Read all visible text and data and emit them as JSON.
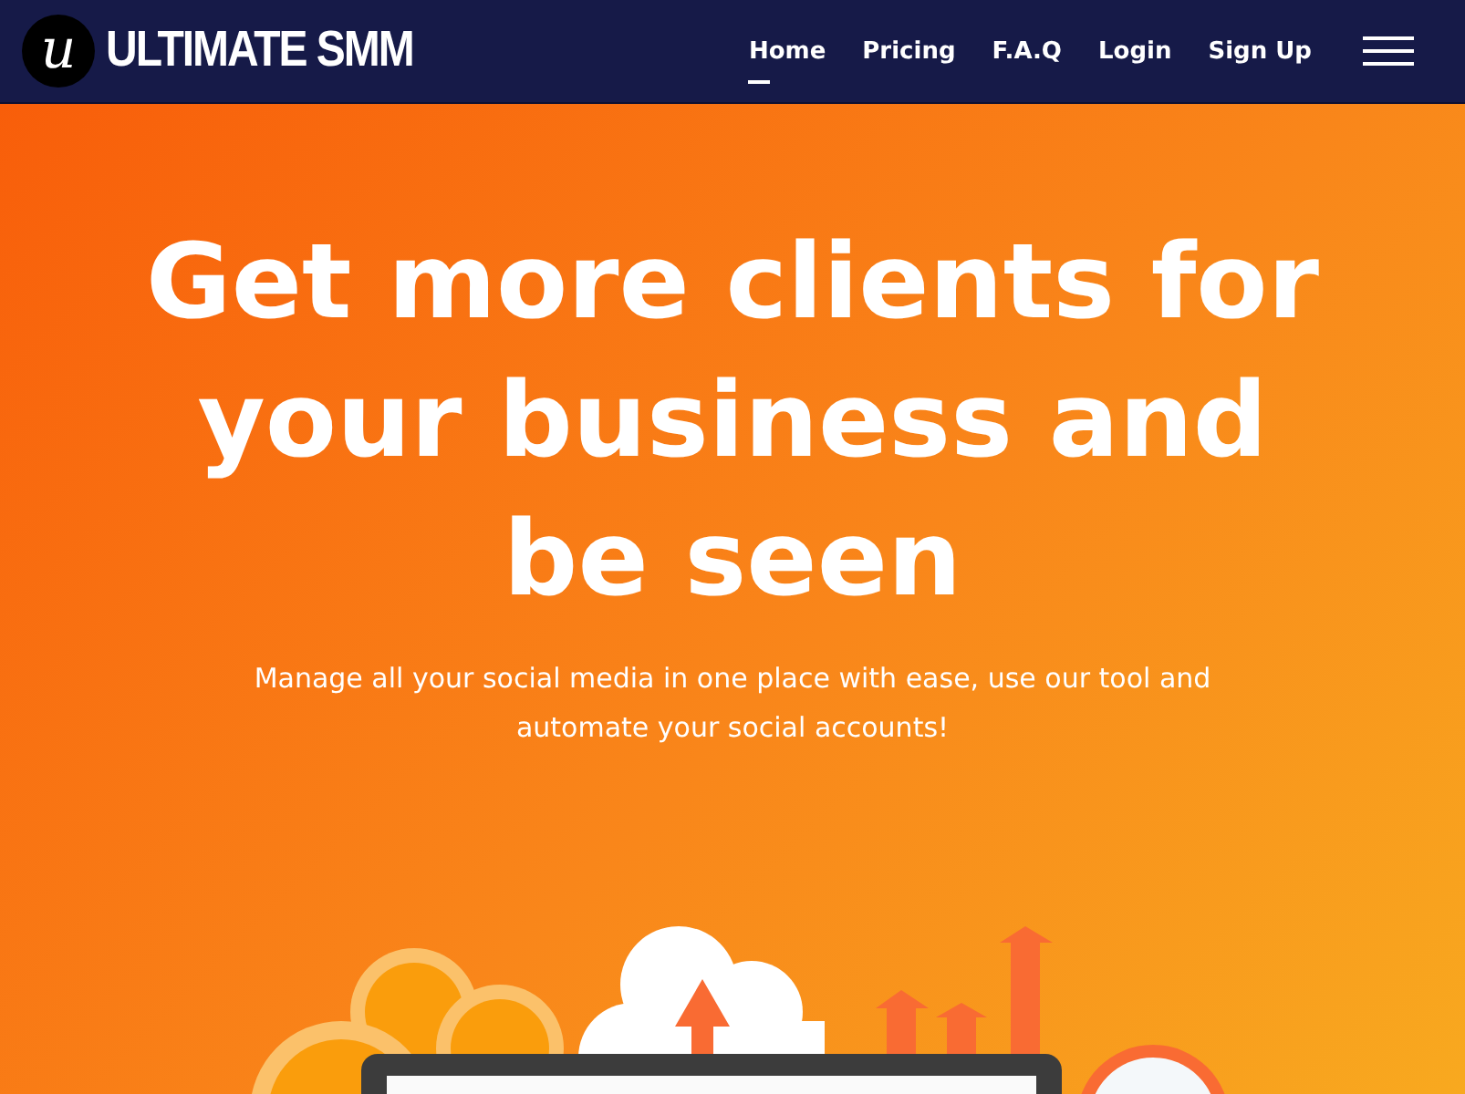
{
  "brand": {
    "logo_letter": "u",
    "name": "ULTIMATE SMM"
  },
  "nav": [
    {
      "label": "Home",
      "selected": true
    },
    {
      "label": "Pricing",
      "selected": false
    },
    {
      "label": "F.A.Q",
      "selected": false
    },
    {
      "label": "Login",
      "selected": false
    },
    {
      "label": "Sign Up",
      "selected": false
    }
  ],
  "hero": {
    "heading": "Get more clients for your business and be seen",
    "subtitle": "Manage all your social media in one place with ease, use our tool and automate your social accounts!"
  }
}
